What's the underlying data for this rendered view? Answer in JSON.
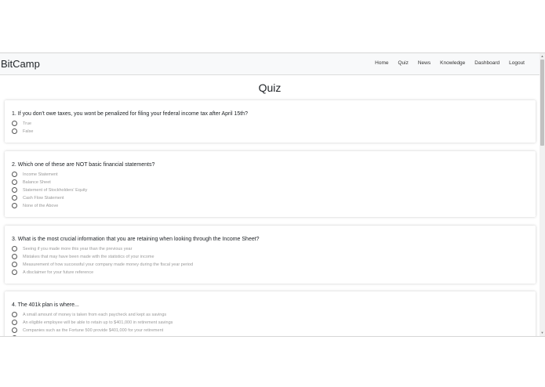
{
  "brand": "BitCamp",
  "nav": [
    "Home",
    "Quiz",
    "News",
    "Knowledge",
    "Dashboard",
    "Logout"
  ],
  "page_title": "Quiz",
  "questions": [
    {
      "text": "1. If you don't owe taxes, you wont be penalized for filing your federal income tax after April 15th?",
      "options": [
        "True",
        "False"
      ]
    },
    {
      "text": "2. Which one of these are NOT basic financial statements?",
      "options": [
        "Income Statement",
        "Balance Sheet",
        "Statement of Stockholders' Equity",
        "Cash Flow Statement",
        "None of the Above"
      ]
    },
    {
      "text": "3. What is the most crucial information that you are retaining when looking through the Income Sheet?",
      "options": [
        "Seeing if you made more this year than the previous year",
        "Mistakes that may have been made with the statistics of your income",
        "Measurement of how successful your company made money during the fiscal year period",
        "A disclaimer for your future reference"
      ]
    },
    {
      "text": "4. The 401k plan is where...",
      "options": [
        "A small amount of money is taken from each paycheck and kept as savings",
        "An eligible employee will be able to retain up to $401,000 in retirement savings",
        "Companies such as the Fortune 500 provide $401,000 for your retirement",
        ""
      ]
    }
  ]
}
